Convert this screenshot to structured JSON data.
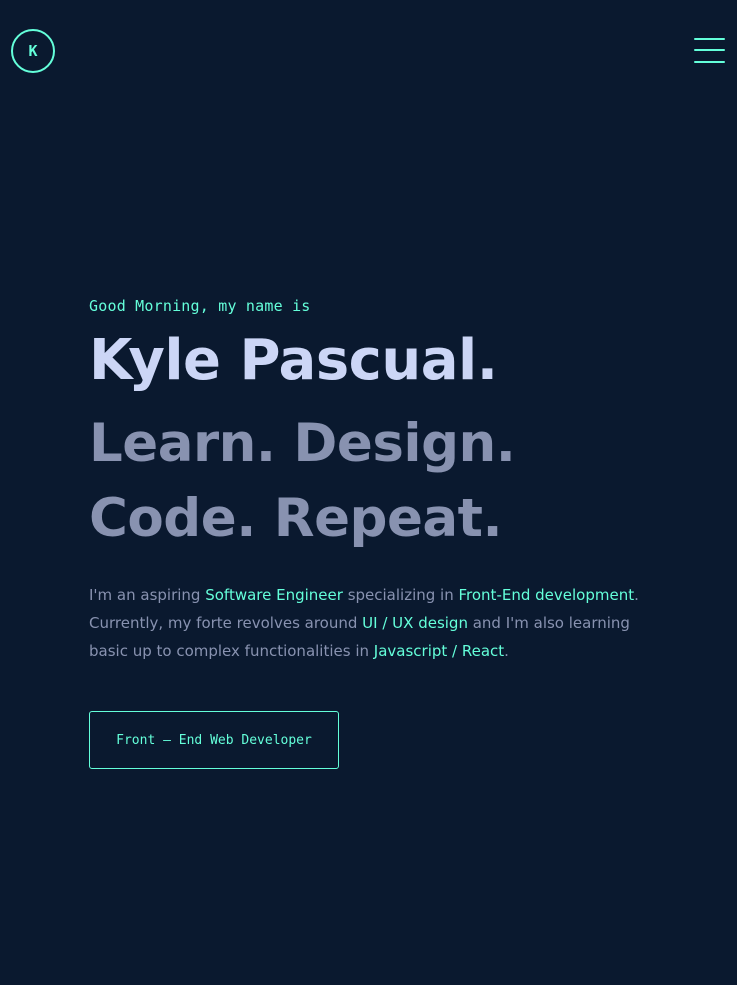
{
  "header": {
    "logo_letter": "K",
    "menu_icon": "hamburger-menu-icon"
  },
  "hero": {
    "greeting": "Good Morning, my name is",
    "name": "Kyle Pascual.",
    "tagline_line1": "Learn. Design.",
    "tagline_line2": "Code. Repeat.",
    "intro": {
      "t1": "I'm an aspiring ",
      "h1": "Software Engineer",
      "t2": " specializing in ",
      "h2": "Front-End development",
      "t3": ". Currently, my forte revolves around ",
      "h3": "UI / UX design",
      "t4": " and I'm also learning basic up to complex functionalities in ",
      "h4": "Javascript / React",
      "t5": "."
    },
    "cta_label": "Front – End Web Developer"
  },
  "colors": {
    "background": "#0a192f",
    "accent": "#64ffda",
    "heading": "#ccd6f6",
    "muted": "#8892b0"
  }
}
